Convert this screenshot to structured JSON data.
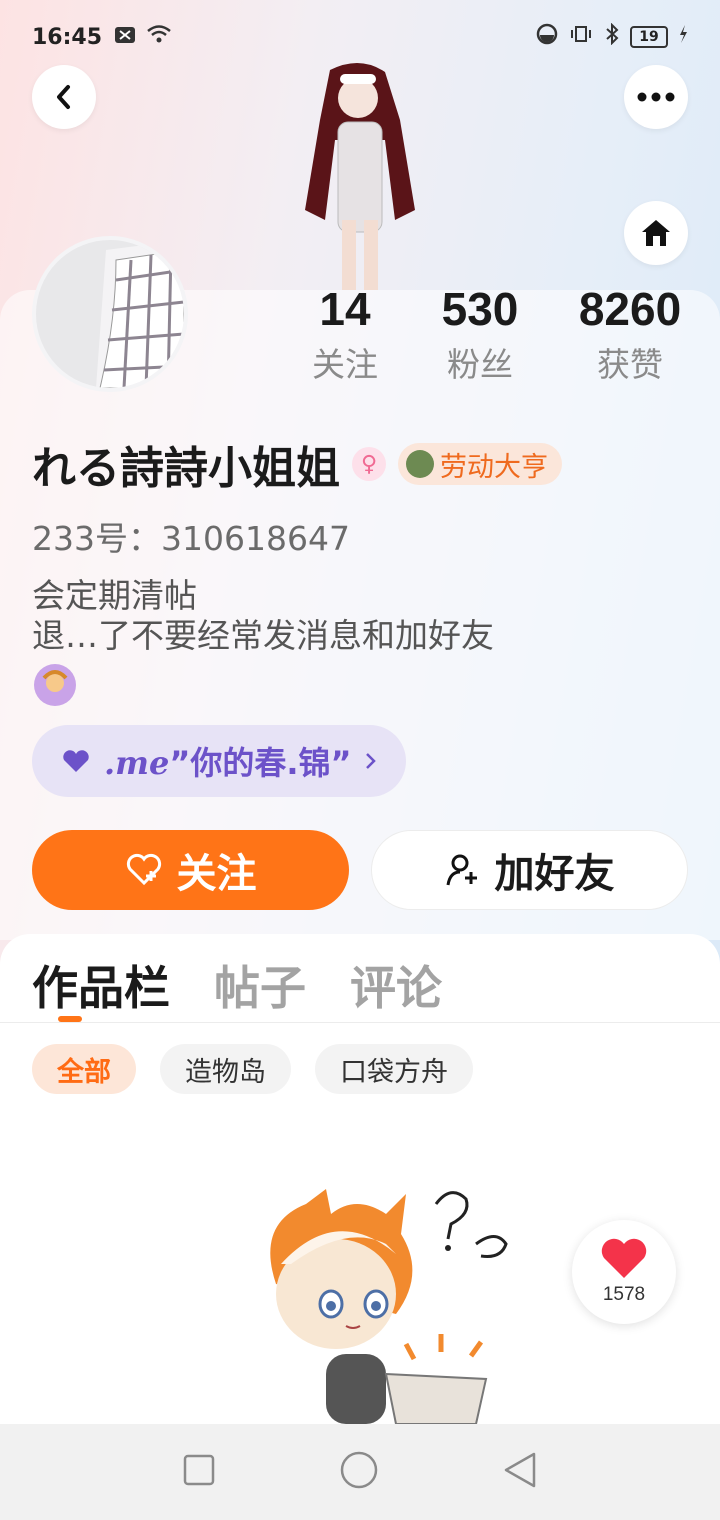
{
  "status_bar": {
    "time": "16:45",
    "battery": "19"
  },
  "profile": {
    "stats": [
      {
        "value": "14",
        "label": "关注"
      },
      {
        "value": "530",
        "label": "粉丝"
      },
      {
        "value": "8260",
        "label": "获赞"
      }
    ],
    "username": "れる詩詩小姐姐",
    "title_badge": "劳动大亨",
    "uid": "233号：310618647",
    "bio_lines": [
      "会定期清帖",
      "退…了不要经常发消息和加好友"
    ],
    "me_tag": {
      "prefix": ".me",
      "text": "”你的春.锦”"
    }
  },
  "actions": {
    "follow_label": "关注",
    "add_friend_label": "加好友"
  },
  "tabs": [
    {
      "label": "作品栏",
      "active": true
    },
    {
      "label": "帖子",
      "active": false
    },
    {
      "label": "评论",
      "active": false
    }
  ],
  "filters": [
    {
      "label": "全部",
      "active": true
    },
    {
      "label": "造物岛",
      "active": false
    },
    {
      "label": "口袋方舟",
      "active": false
    }
  ],
  "like_fab": {
    "count": "1578"
  },
  "colors": {
    "accent": "#ff7417",
    "me_tag": "#6c52c9"
  }
}
